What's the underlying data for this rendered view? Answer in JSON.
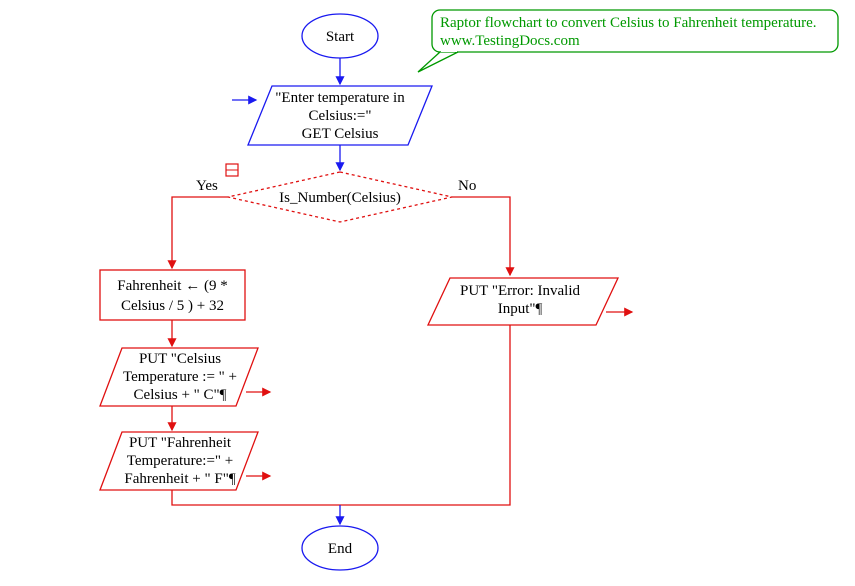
{
  "callout": {
    "line1": "Raptor flowchart to convert Celsius to Fahrenheit temperature.",
    "line2": "www.TestingDocs.com"
  },
  "nodes": {
    "start": "Start",
    "input_l1": "\"Enter temperature in",
    "input_l2": "Celsius:=\"",
    "input_l3": "GET Celsius",
    "decision": "Is_Number(Celsius)",
    "yes": "Yes",
    "no": "No",
    "assign_l1": "Fahrenheit ← (9 *",
    "assign_l2": "Celsius / 5 )  +  32",
    "outC_l1": "PUT \"Celsius",
    "outC_l2": "Temperature := \" +",
    "outC_l3": "Celsius + \" C\"¶",
    "outF_l1": "PUT \"Fahrenheit",
    "outF_l2": "Temperature:=\" +",
    "outF_l3": "Fahrenheit + \" F\"¶",
    "err_l1": "PUT \"Error: Invalid",
    "err_l2": "Input\"¶",
    "end": "End"
  },
  "colors": {
    "blue": "#1a1af0",
    "red": "#e01010",
    "green": "#009900"
  }
}
